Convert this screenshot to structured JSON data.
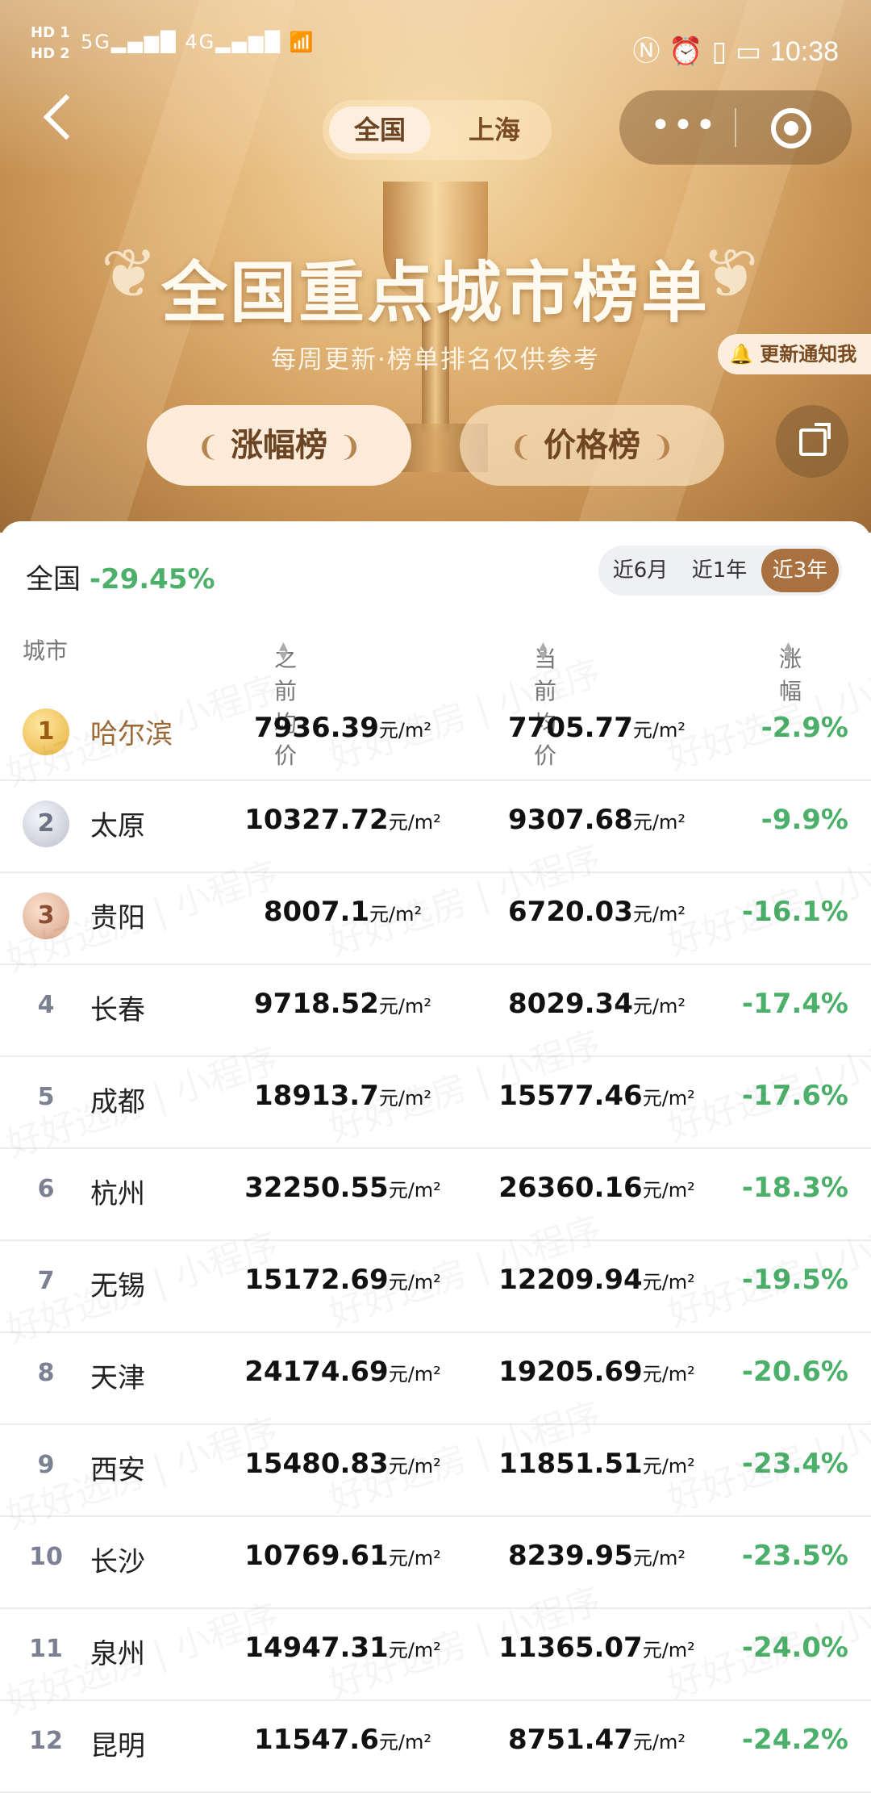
{
  "status_bar": {
    "left": [
      "HD 1",
      "HD 2"
    ],
    "signal_a": "5G",
    "signal_b": "4G",
    "time": "10:38",
    "icons": [
      "nfc-icon",
      "alarm-icon",
      "vibrate-icon",
      "battery-icon",
      "wifi-icon"
    ]
  },
  "nav": {
    "back_icon": "chevron-left-icon",
    "scope_tabs": [
      "全国",
      "上海"
    ],
    "selected_scope": "全国",
    "menu_icon": "more-dots-icon",
    "close_icon": "target-icon"
  },
  "hero": {
    "title": "全国重点城市榜单",
    "subtitle": "每周更新·榜单排名仅供参考",
    "notify_label": "更新通知我",
    "notify_icon": "bell-icon",
    "rank_tabs": [
      "涨幅榜",
      "价格榜"
    ],
    "share_icon": "share-icon"
  },
  "summary": {
    "label": "全国",
    "value": "-29.45%",
    "periods": [
      "近6月",
      "近1年",
      "近3年"
    ],
    "selected_period": "近3年"
  },
  "table": {
    "headers": {
      "city": "城市",
      "previous": "之前均价",
      "current": "当前均价",
      "change": "涨幅"
    },
    "unit": "元/m²",
    "rows": [
      {
        "rank": "1",
        "city": "哈尔滨",
        "previous": "7936.39",
        "current": "7705.77",
        "change": "-2.9%"
      },
      {
        "rank": "2",
        "city": "太原",
        "previous": "10327.72",
        "current": "9307.68",
        "change": "-9.9%"
      },
      {
        "rank": "3",
        "city": "贵阳",
        "previous": "8007.1",
        "current": "6720.03",
        "change": "-16.1%"
      },
      {
        "rank": "4",
        "city": "长春",
        "previous": "9718.52",
        "current": "8029.34",
        "change": "-17.4%"
      },
      {
        "rank": "5",
        "city": "成都",
        "previous": "18913.7",
        "current": "15577.46",
        "change": "-17.6%"
      },
      {
        "rank": "6",
        "city": "杭州",
        "previous": "32250.55",
        "current": "26360.16",
        "change": "-18.3%"
      },
      {
        "rank": "7",
        "city": "无锡",
        "previous": "15172.69",
        "current": "12209.94",
        "change": "-19.5%"
      },
      {
        "rank": "8",
        "city": "天津",
        "previous": "24174.69",
        "current": "19205.69",
        "change": "-20.6%"
      },
      {
        "rank": "9",
        "city": "西安",
        "previous": "15480.83",
        "current": "11851.51",
        "change": "-23.4%"
      },
      {
        "rank": "10",
        "city": "长沙",
        "previous": "10769.61",
        "current": "8239.95",
        "change": "-23.5%"
      },
      {
        "rank": "11",
        "city": "泉州",
        "previous": "14947.31",
        "current": "11365.07",
        "change": "-24.0%"
      },
      {
        "rank": "12",
        "city": "昆明",
        "previous": "11547.6",
        "current": "8751.47",
        "change": "-24.2%"
      }
    ]
  },
  "watermark": "好好选房 | 小程序",
  "colors": {
    "accent": "#a8713f",
    "negative_change": "#4caf6a",
    "gold": "#e7b13d",
    "silver": "#b9bfcc",
    "bronze": "#d7a286"
  }
}
